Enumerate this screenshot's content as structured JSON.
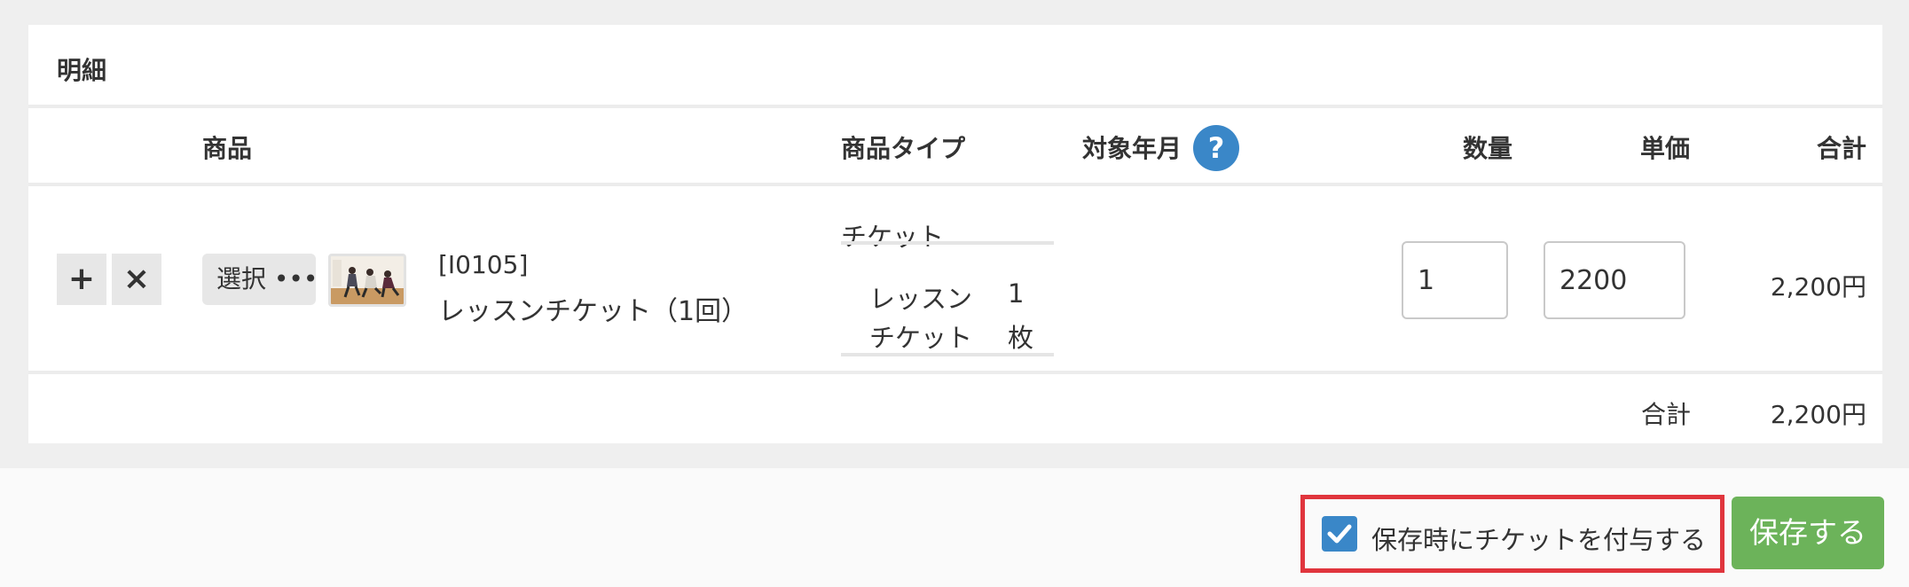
{
  "panel": {
    "title": "明細"
  },
  "table": {
    "headers": {
      "product": "商品",
      "product_type": "商品タイプ",
      "target_month": "対象年月",
      "quantity": "数量",
      "unit_price": "単価",
      "total": "合計"
    },
    "help_icon_glyph": "?",
    "row": {
      "add_glyph": "+",
      "remove_glyph": "×",
      "select_label": "選択 •••",
      "product_code": "[I0105]",
      "product_name": "レッスンチケット（1回）",
      "product_type": "チケット",
      "ticket_lines": [
        {
          "label": "レッスン",
          "value": "1"
        },
        {
          "label": "チケット",
          "value": "枚"
        }
      ],
      "quantity": "1",
      "unit_price": "2200",
      "row_total": "2,200円"
    },
    "summary": {
      "label": "合計",
      "value": "2,200円"
    }
  },
  "footer": {
    "grant_ticket_checkbox_label": "保存時にチケットを付与する",
    "grant_ticket_checked": true,
    "save_label": "保存する"
  },
  "colors": {
    "accent_blue": "#3a87c8",
    "save_green": "#6cb35a",
    "highlight_red": "#e0353d"
  }
}
